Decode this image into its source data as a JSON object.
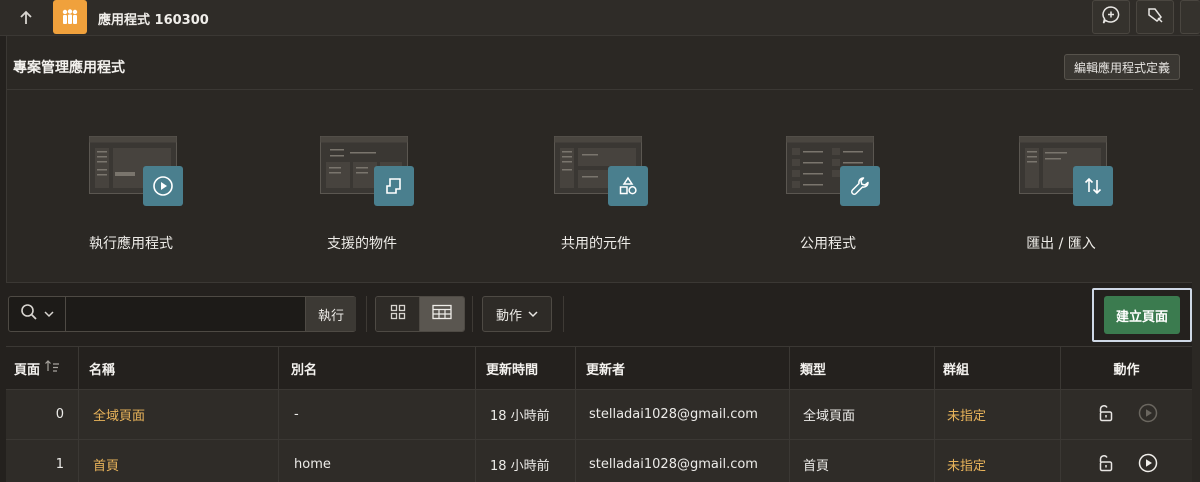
{
  "topbar": {
    "app_title": "應用程式 160300",
    "icons": [
      "arrow-up-icon",
      "app-people-icon",
      "feedback-icon",
      "developer-tool-icon"
    ]
  },
  "region": {
    "title": "專案管理應用程式",
    "edit_button": "編輯應用程式定義"
  },
  "tiles": [
    {
      "label": "執行應用程式",
      "icon": "play-icon"
    },
    {
      "label": "支援的物件",
      "icon": "scroll-icon"
    },
    {
      "label": "共用的元件",
      "icon": "shapes-icon"
    },
    {
      "label": "公用程式",
      "icon": "wrench-icon"
    },
    {
      "label": "匯出 / 匯入",
      "icon": "arrows-updown-icon"
    }
  ],
  "toolbar": {
    "search_placeholder": "",
    "go_button": "執行",
    "actions_button": "動作",
    "create_button": "建立頁面"
  },
  "table": {
    "headers": {
      "page": "頁面",
      "name": "名稱",
      "alias": "別名",
      "updated": "更新時間",
      "updated_by": "更新者",
      "type": "類型",
      "group": "群組",
      "actions": "動作"
    },
    "rows": [
      {
        "page": "0",
        "name": "全域頁面",
        "alias": "-",
        "updated": "18 小時前",
        "updated_by": "stelladai1028@gmail.com",
        "type": "全域頁面",
        "group": "未指定"
      },
      {
        "page": "1",
        "name": "首頁",
        "alias": "home",
        "updated": "18 小時前",
        "updated_by": "stelladai1028@gmail.com",
        "type": "首頁",
        "group": "未指定"
      }
    ]
  },
  "colors": {
    "accent_orange": "#f0a13c",
    "tile_badge": "#4a7f8e",
    "create_green": "#3b7b4f",
    "link_gold": "#e8b35a"
  }
}
